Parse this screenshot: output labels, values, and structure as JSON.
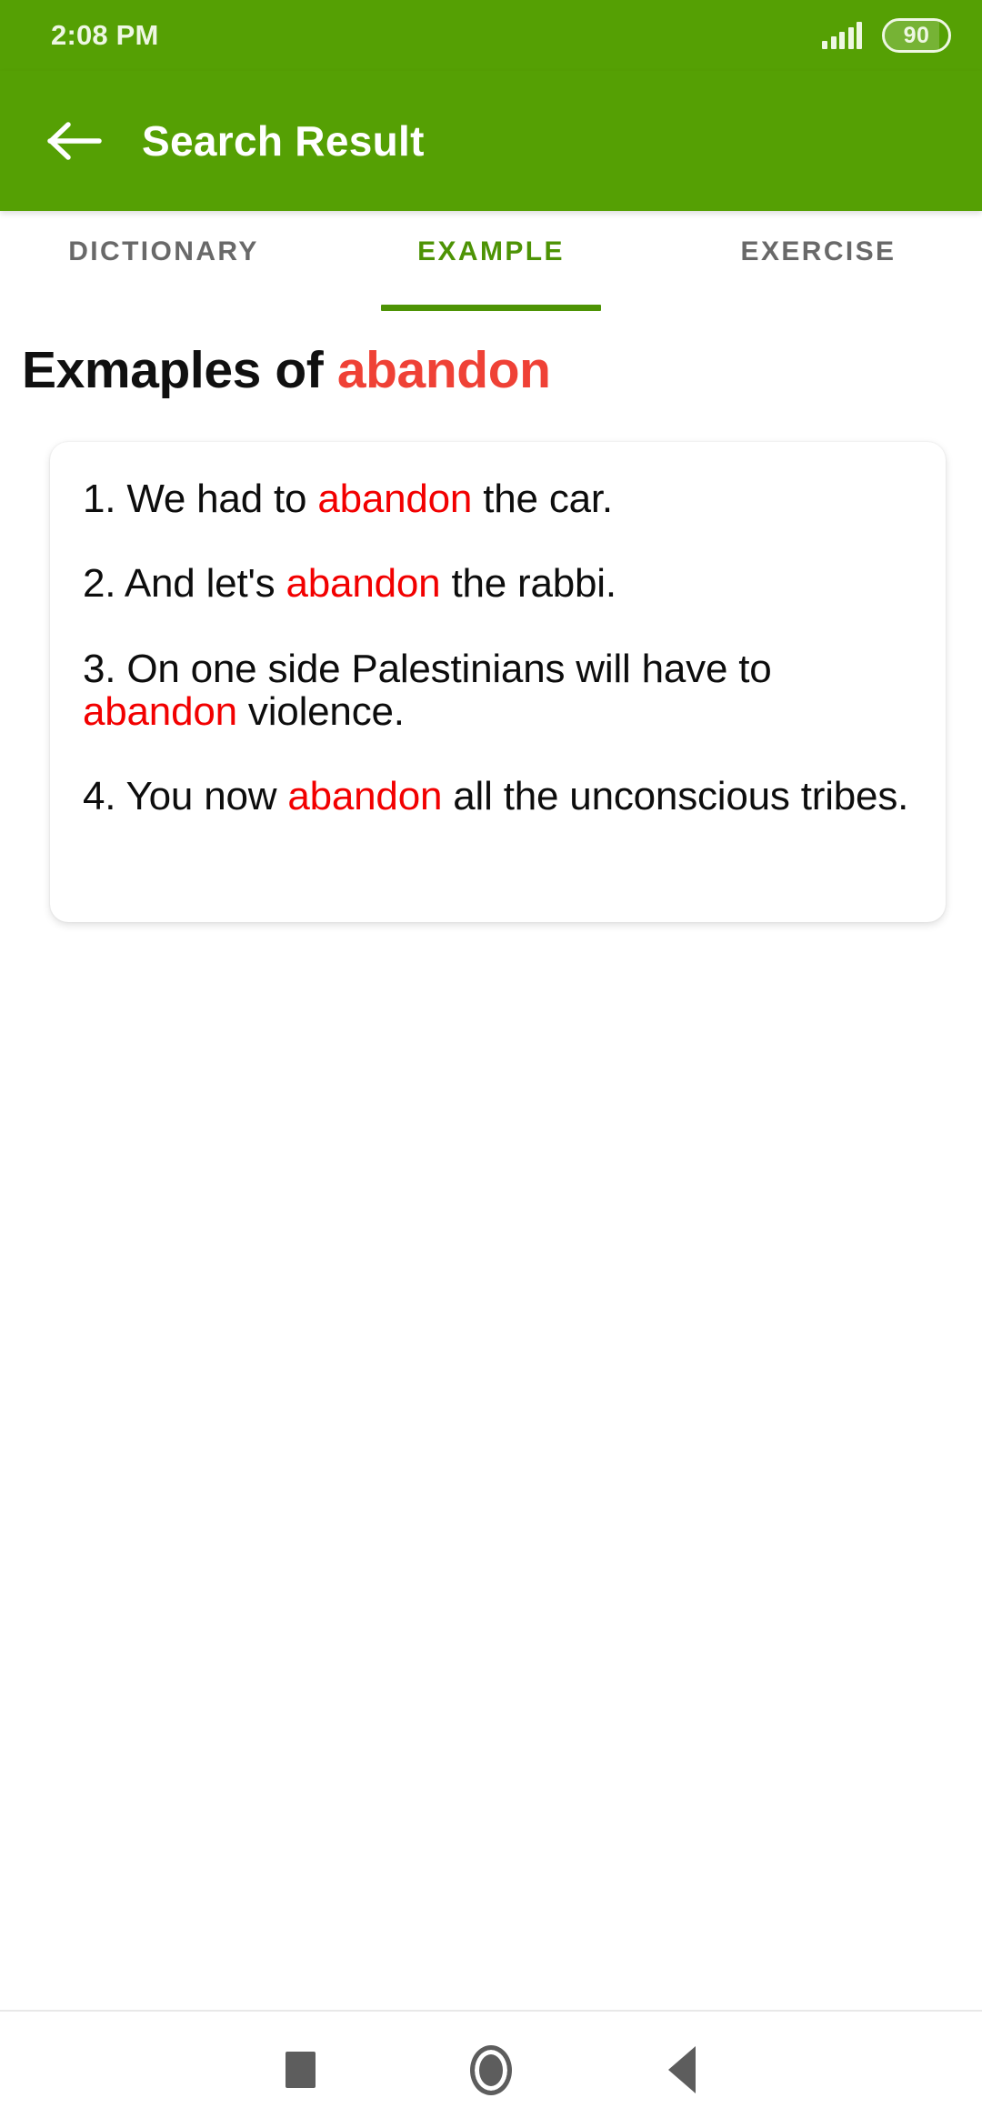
{
  "theme": {
    "primary_green": "#55a004",
    "tab_active_green": "#4d9305",
    "title_keyword_red": "#ef4136",
    "example_keyword_red": "#f20000"
  },
  "status_bar": {
    "time": "2:08 PM",
    "signal_icon": "cellular-signal-icon",
    "battery_icon": "battery-icon",
    "battery_level": "90"
  },
  "app_bar": {
    "back_icon": "arrow-left-icon",
    "title": "Search Result"
  },
  "tabs": [
    {
      "label": "DICTIONARY",
      "active": false
    },
    {
      "label": "EXAMPLE",
      "active": true
    },
    {
      "label": "EXERCISE",
      "active": false
    }
  ],
  "content": {
    "heading_prefix": "Exmaples of ",
    "heading_keyword": "abandon",
    "keyword": "abandon",
    "examples": [
      {
        "number": "1.",
        "before": " We had to ",
        "keyword": "abandon",
        "after": " the car."
      },
      {
        "number": "2.",
        "before": " And let's ",
        "keyword": "abandon",
        "after": " the rabbi."
      },
      {
        "number": "3.",
        "before": " On one side Palestinians will have to ",
        "keyword": "abandon",
        "after": " violence."
      },
      {
        "number": "4.",
        "before": " You now ",
        "keyword": "abandon",
        "after": " all the unconscious tribes."
      }
    ]
  },
  "nav_bar": {
    "recents_icon": "square-recents-icon",
    "home_icon": "circle-home-icon",
    "back_icon": "triangle-back-icon"
  }
}
